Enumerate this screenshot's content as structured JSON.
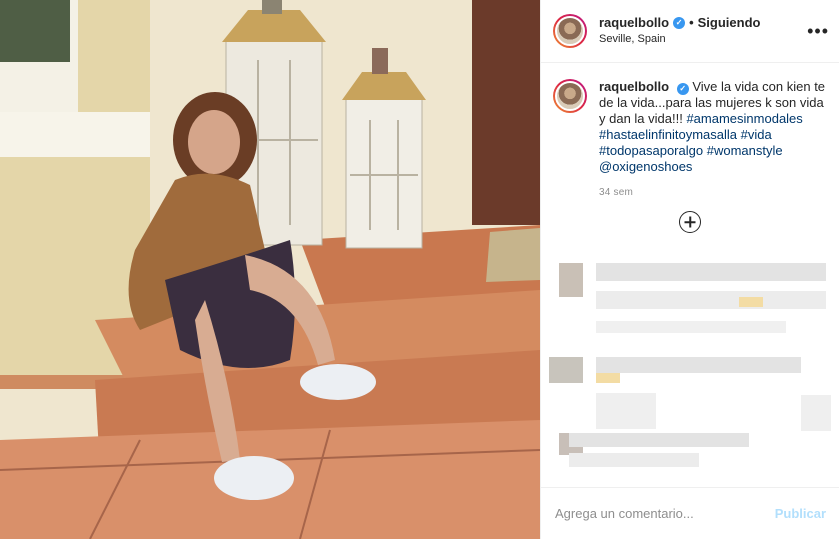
{
  "post": {
    "username": "raquelbollo",
    "follow_status": "Siguiendo",
    "separator": "•",
    "location": "Seville, Spain",
    "more_icon": "more-horizontal-icon",
    "verified_icon": "verified-badge-icon"
  },
  "caption": {
    "username": "raquelbollo",
    "text": "Vive la vida con kien te de la vida...para las mujeres k son vida y dan la vida!!!",
    "hashtags": [
      "#amamesinmodales",
      "#hastaelinfinitoymasalla",
      "#vida",
      "#todopasaporalgo",
      "#womanstyle",
      "@oxigenoshoes"
    ],
    "time": "34 sem"
  },
  "comments": {
    "load_more_icon": "plus-circle-icon"
  },
  "footer": {
    "placeholder": "Agrega un comentario...",
    "publish_label": "Publicar"
  },
  "colors": {
    "link": "#00376b",
    "verified": "#3897f0",
    "publish_disabled": "#b2dffc",
    "muted": "#8e8e8e"
  }
}
